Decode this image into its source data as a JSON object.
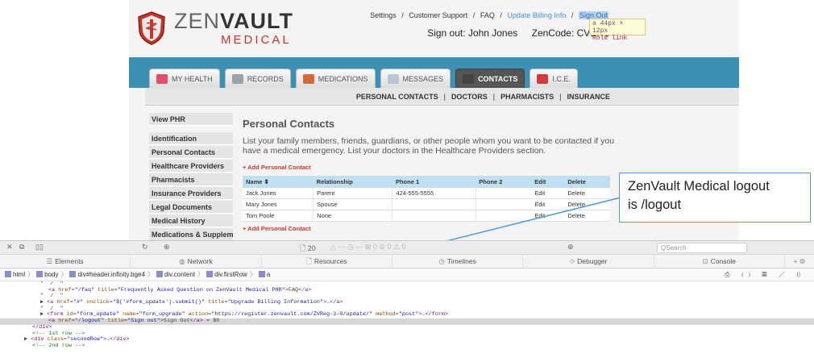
{
  "site": {
    "logo_main": "ZEN",
    "logo_bold": "VAULT",
    "logo_sub": "MEDICAL",
    "top_links": [
      "Settings",
      "Customer Support",
      "FAQ",
      "Update Billing Info",
      "Sign Out"
    ],
    "separator": "/",
    "signout_label": "Sign out: John Jones",
    "zencode_label": "ZenCode: CVEXC",
    "inspector_tip_line1": "a 44px × 12px",
    "inspector_tip_line2": "Role link"
  },
  "tabs": [
    {
      "label": "MY HEALTH",
      "color": "#e0506a"
    },
    {
      "label": "RECORDS",
      "color": "#9aa3ad"
    },
    {
      "label": "MEDICATIONS",
      "color": "#d46a3a"
    },
    {
      "label": "MESSAGES",
      "color": "#b9c6d6"
    },
    {
      "label": "CONTACTS",
      "color": "#444444",
      "active": true
    },
    {
      "label": "I.C.E.",
      "color": "#d23b3b"
    }
  ],
  "subnav": [
    "PERSONAL CONTACTS",
    "DOCTORS",
    "PHARMACISTS",
    "INSURANCE"
  ],
  "sidebar": [
    "View PHR",
    "Identification",
    "Personal Contacts",
    "Healthcare Providers",
    "Pharmacists",
    "Insurance Providers",
    "Legal Documents",
    "Medical History",
    "Medications & Supplements"
  ],
  "main": {
    "title": "Personal Contacts",
    "description": "List your family members, friends, guardians, or other people whom you want to be contacted if you have a medical emergency. List your doctors in the Healthcare Providers section.",
    "add_link": "+ Add Personal Contact",
    "columns": [
      "Name ⬍",
      "Relationship",
      "Phone 1",
      "Phone 2",
      "Edit",
      "Delete"
    ],
    "rows": [
      [
        "Jack Jones",
        "Parent",
        "424-555-5555",
        "",
        "Edit",
        "Delete"
      ],
      [
        "Mary Jones",
        "Spouse",
        "",
        "",
        "Edit",
        "Delete"
      ],
      [
        "Tom Poole",
        "None",
        "",
        "",
        "Edit",
        "Delete"
      ]
    ]
  },
  "callout": {
    "line1": "ZenVault Medical logout",
    "line2": "is /logout"
  },
  "devtools": {
    "resource_count": "20",
    "search_placeholder": "Search",
    "tabs": [
      "Elements",
      "Network",
      "Resources",
      "Timelines",
      "Debugger",
      "Console"
    ],
    "breadcrumb": [
      "html",
      "body",
      "div#header.infinity.bge4",
      "div.content",
      "div.firstRow",
      "a"
    ],
    "dom_lines": [
      {
        "indent": 10,
        "html": "\"  /  \""
      },
      {
        "indent": 12,
        "html": "<span class='tag'>&lt;a</span> <span class='attr'>href</span>=<span class='val'>\"/faq\"</span> <span class='attr'>title</span>=<span class='val'>\"Frequently Asked Question on ZenVault Medical PHR\"</span><span class='tag'>&gt;</span>FAQ<span class='tag'>&lt;/a&gt;</span>"
      },
      {
        "indent": 10,
        "html": "\"  /  \""
      },
      {
        "indent": 10,
        "html": "▶ <span class='tag'>&lt;a</span> <span class='attr'>href</span>=<span class='val'>\"#\"</span> <span class='attr'>onclick</span>=<span class='val'>\"$('#form_update').submit()\"</span> <span class='attr'>title</span>=<span class='val'>\"Upgrade Billing Information\"</span><span class='tag'>&gt;</span>…<span class='tag'>&lt;/a&gt;</span>"
      },
      {
        "indent": 10,
        "html": "\"  /  \""
      },
      {
        "indent": 10,
        "html": "▶ <span class='tag'>&lt;form</span> <span class='attr'>id</span>=<span class='val'>\"form_update\"</span> <span class='attr'>name</span>=<span class='val'>\"form_upgrade\"</span> <span class='attr'>action</span>=<span class='val'>\"https://register.zenvault.com/ZVReg-3-0/update/\"</span> <span class='attr'>method</span>=<span class='val'>\"post\"</span><span class='tag'>&gt;</span>…<span class='tag'>&lt;/form&gt;</span>"
      },
      {
        "indent": 12,
        "html": "<span class='tag'>&lt;a</span> <span class='attr'>href</span>=<span class='val'>\"/logout\"</span> <span class='attr'>title</span>=<span class='val'>\"Sign out\"</span><span class='tag'>&gt;</span>Sign Out<span class='tag'>&lt;/a&gt;</span> = $0",
        "selected": true
      },
      {
        "indent": 8,
        "html": "<span class='tag'>&lt;/div&gt;</span>"
      },
      {
        "indent": 8,
        "html": "<span class='cmt'>&lt;!-- 1st row --&gt;</span>"
      },
      {
        "indent": 6,
        "html": "▶ <span class='tag'>&lt;div</span> <span class='attr'>class</span>=<span class='val'>\"secondRow\"</span><span class='tag'>&gt;</span>…<span class='tag'>&lt;/div&gt;</span>"
      },
      {
        "indent": 8,
        "html": "<span class='cmt'>&lt;!-- 2nd row --&gt;</span>"
      }
    ]
  }
}
